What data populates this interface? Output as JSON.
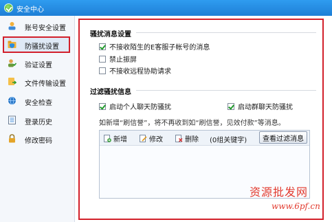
{
  "window": {
    "title": "安全中心"
  },
  "sidebar": {
    "items": [
      {
        "label": "账号安全设置",
        "icon": "user-badge-icon"
      },
      {
        "label": "防骚扰设置",
        "icon": "folder-shield-icon",
        "active": true
      },
      {
        "label": "验证设置",
        "icon": "person-check-icon"
      },
      {
        "label": "文件传输设置",
        "icon": "file-transfer-icon"
      },
      {
        "label": "安全检查",
        "icon": "globe-check-icon"
      },
      {
        "label": "登录历史",
        "icon": "history-list-icon"
      },
      {
        "label": "修改密码",
        "icon": "lock-icon"
      }
    ]
  },
  "harass": {
    "title": "骚扰消息设置",
    "options": [
      {
        "label": "不接收陌生的E客服子帐号的消息",
        "checked": true
      },
      {
        "label": "禁止振屏",
        "checked": false
      },
      {
        "label": "不接收远程协助请求",
        "checked": false
      }
    ]
  },
  "filter": {
    "title": "过滤骚扰信息",
    "personal_label": "启动个人聊天防骚扰",
    "personal_checked": true,
    "group_label": "启动群聊天防骚扰",
    "group_checked": true,
    "description": "如新增“刷信誉”，将不再收到如“刷信誉，见效付款”等消息。",
    "toolbar": {
      "add": "新增",
      "edit": "修改",
      "delete": "删除",
      "count": "(0组关键字)",
      "view": "查看过滤消息"
    }
  },
  "watermark": {
    "brand": "资源批发网",
    "url": "www.6pf.cn"
  },
  "colors": {
    "titlebar": "#1e7fd6",
    "highlight": "#d21f2a",
    "check": "#1f9a2a"
  }
}
